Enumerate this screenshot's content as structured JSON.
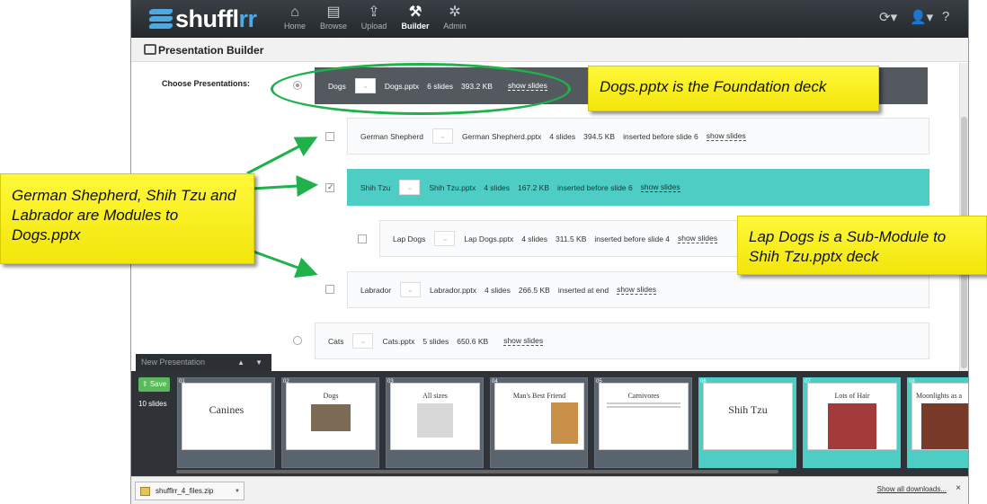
{
  "nav": {
    "logo_text": "shuffl",
    "logo_accent": "rr",
    "items": [
      {
        "label": "Home",
        "icon": "home-icon",
        "glyph": "⌂"
      },
      {
        "label": "Browse",
        "icon": "browse-icon",
        "glyph": "▤"
      },
      {
        "label": "Upload",
        "icon": "upload-icon",
        "glyph": "⇪"
      },
      {
        "label": "Builder",
        "icon": "wrench-icon",
        "glyph": "⚒"
      },
      {
        "label": "Admin",
        "icon": "gear-icon",
        "glyph": "✲"
      }
    ],
    "right_icons": [
      "refresh-icon",
      "user-icon",
      "help-icon"
    ],
    "right_glyphs": [
      "⟳▾",
      "👤▾",
      "?"
    ]
  },
  "page": {
    "title": "Presentation Builder"
  },
  "choose_label": "Choose Presentations:",
  "presentations": [
    {
      "name": "Dogs",
      "file": "Dogs.pptx",
      "slides": "6 slides",
      "size": "393.2 KB",
      "note": "",
      "link": "show slides",
      "selected": true
    },
    {
      "name": "German Shepherd",
      "file": "German Shepherd.pptx",
      "slides": "4 slides",
      "size": "394.5 KB",
      "note": "inserted before slide 6",
      "link": "show slides",
      "checked": false
    },
    {
      "name": "Shih Tzu",
      "file": "Shih Tzu.pptx",
      "slides": "4 slides",
      "size": "167.2 KB",
      "note": "inserted before slide 6",
      "link": "show slides",
      "checked": true
    },
    {
      "name": "Lap Dogs",
      "file": "Lap Dogs.pptx",
      "slides": "4 slides",
      "size": "311.5 KB",
      "note": "inserted before slide 4",
      "link": "show slides",
      "checked": false
    },
    {
      "name": "Labrador",
      "file": "Labrador.pptx",
      "slides": "4 slides",
      "size": "266.5 KB",
      "note": "inserted at end",
      "link": "show slides",
      "checked": false
    },
    {
      "name": "Cats",
      "file": "Cats.pptx",
      "slides": "5 slides",
      "size": "650.6 KB",
      "note": "",
      "link": "show slides",
      "selected": false
    }
  ],
  "tray": {
    "title": "New Presentation",
    "save_label": "Save",
    "slide_count": "10 slides",
    "slides": [
      {
        "num": "01",
        "title": "Canines"
      },
      {
        "num": "02",
        "title": "Dogs"
      },
      {
        "num": "03",
        "title": "All sizes"
      },
      {
        "num": "04",
        "title": "Man's Best Friend"
      },
      {
        "num": "05",
        "title": "Carnivores"
      },
      {
        "num": "06",
        "title": "Shih Tzu"
      },
      {
        "num": "07",
        "title": "Lots of Hair"
      },
      {
        "num": "08",
        "title": "Moonlights as a"
      }
    ]
  },
  "downloads": {
    "file": "shufflrr_4_files.zip",
    "show_all": "Show all downloads...",
    "close": "×"
  },
  "callouts": {
    "foundation": "Dogs.pptx is the Foundation deck",
    "modules": "German Shepherd, Shih Tzu and Labrador are Modules to Dogs.pptx",
    "submodule": "Lap Dogs is a Sub-Module to Shih Tzu.pptx deck"
  },
  "colors": {
    "teal": "#4ecdc4",
    "dark_row": "#53595f",
    "callout_yellow": "#f7ee1e",
    "arrow_green": "#1fb24a",
    "nav_bg": "#2a2e33"
  }
}
